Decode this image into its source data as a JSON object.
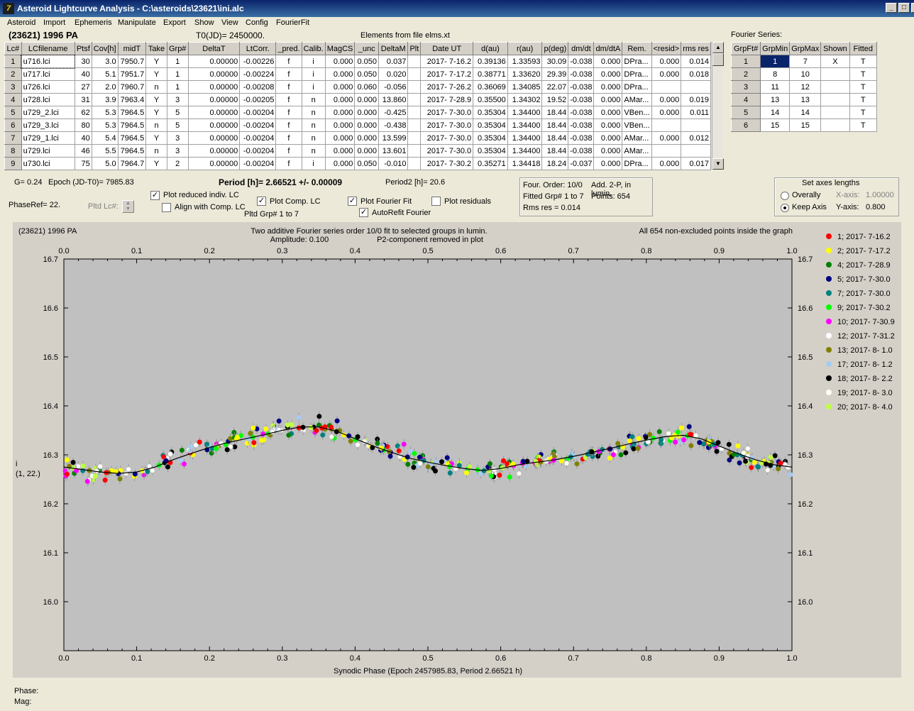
{
  "window": {
    "title": "Asteroid Lightcurve Analysis - C:\\asteroids\\23621\\ini.alc",
    "min": "_",
    "max": "□",
    "close": "X"
  },
  "menu": [
    "Asteroid",
    "Import",
    "Ephemeris",
    "Manipulate",
    "Export",
    "Show",
    "View",
    "Config",
    "FourierFit"
  ],
  "header": {
    "asteroid": "(23621) 1996 PA",
    "t0": "T0(JD)= 2450000.",
    "elements": "Elements from file elms.xt"
  },
  "lc_table": {
    "columns": [
      "Lc#",
      "LCfilename",
      "Ptsf",
      "Cov[h]",
      "midT",
      "Take",
      "Grp#",
      "DeltaT",
      "LtCorr.",
      "_pred.",
      "Calib.",
      "MagCS",
      "_unc",
      "DeltaM",
      "Plt",
      "Date UT",
      "d(au)",
      "r(au)",
      "p(deg)",
      "dm/dt",
      "dm/dtA",
      "Rem.",
      "<resid>",
      "rms res"
    ],
    "rows": [
      [
        "1",
        "u716.lci",
        "30",
        "3.0",
        "7950.7",
        "Y",
        "1",
        "0.00000",
        "-0.00226",
        "f",
        "i",
        "0.000",
        "0.050",
        "0.037",
        "",
        "2017- 7-16.2",
        "0.39136",
        "1.33593",
        "30.09",
        "-0.038",
        "0.000",
        "DPra...",
        "0.000",
        "0.014"
      ],
      [
        "2",
        "u717.lci",
        "40",
        "5.1",
        "7951.7",
        "Y",
        "1",
        "0.00000",
        "-0.00224",
        "f",
        "i",
        "0.000",
        "0.050",
        "0.020",
        "",
        "2017- 7-17.2",
        "0.38771",
        "1.33620",
        "29.39",
        "-0.038",
        "0.000",
        "DPra...",
        "0.000",
        "0.018"
      ],
      [
        "3",
        "u726.lci",
        "27",
        "2.0",
        "7960.7",
        "n",
        "1",
        "0.00000",
        "-0.00208",
        "f",
        "i",
        "0.000",
        "0.060",
        "-0.056",
        "",
        "2017- 7-26.2",
        "0.36069",
        "1.34085",
        "22.07",
        "-0.038",
        "0.000",
        "DPra...",
        "",
        ""
      ],
      [
        "4",
        "u728.lci",
        "31",
        "3.9",
        "7963.4",
        "Y",
        "3",
        "0.00000",
        "-0.00205",
        "f",
        "n",
        "0.000",
        "0.000",
        "13.860",
        "",
        "2017- 7-28.9",
        "0.35500",
        "1.34302",
        "19.52",
        "-0.038",
        "0.000",
        "AMar...",
        "0.000",
        "0.019"
      ],
      [
        "5",
        "u729_2.lci",
        "62",
        "5.3",
        "7964.5",
        "Y",
        "5",
        "0.00000",
        "-0.00204",
        "f",
        "n",
        "0.000",
        "0.000",
        "-0.425",
        "",
        "2017- 7-30.0",
        "0.35304",
        "1.34400",
        "18.44",
        "-0.038",
        "0.000",
        "VBen...",
        "0.000",
        "0.011"
      ],
      [
        "6",
        "u729_3.lci",
        "80",
        "5.3",
        "7964.5",
        "n",
        "5",
        "0.00000",
        "-0.00204",
        "f",
        "n",
        "0.000",
        "0.000",
        "-0.438",
        "",
        "2017- 7-30.0",
        "0.35304",
        "1.34400",
        "18.44",
        "-0.038",
        "0.000",
        "VBen...",
        "",
        ""
      ],
      [
        "7",
        "u729_1.lci",
        "40",
        "5.4",
        "7964.5",
        "Y",
        "3",
        "0.00000",
        "-0.00204",
        "f",
        "n",
        "0.000",
        "0.000",
        "13.599",
        "",
        "2017- 7-30.0",
        "0.35304",
        "1.34400",
        "18.44",
        "-0.038",
        "0.000",
        "AMar...",
        "0.000",
        "0.012"
      ],
      [
        "8",
        "u729.lci",
        "46",
        "5.5",
        "7964.5",
        "n",
        "3",
        "0.00000",
        "-0.00204",
        "f",
        "n",
        "0.000",
        "0.000",
        "13.601",
        "",
        "2017- 7-30.0",
        "0.35304",
        "1.34400",
        "18.44",
        "-0.038",
        "0.000",
        "AMar...",
        "",
        ""
      ],
      [
        "9",
        "u730.lci",
        "75",
        "5.0",
        "7964.7",
        "Y",
        "2",
        "0.00000",
        "-0.00204",
        "f",
        "i",
        "0.000",
        "0.050",
        "-0.010",
        "",
        "2017- 7-30.2",
        "0.35271",
        "1.34418",
        "18.24",
        "-0.037",
        "0.000",
        "DPra...",
        "0.000",
        "0.017"
      ]
    ]
  },
  "fourier": {
    "label": "Fourier Series:",
    "columns": [
      "GrpFt#",
      "GrpMin",
      "GrpMax",
      "Shown",
      "Fitted"
    ],
    "rows": [
      [
        "1",
        "1",
        "7",
        "X",
        "T"
      ],
      [
        "2",
        "8",
        "10",
        "",
        "T"
      ],
      [
        "3",
        "11",
        "12",
        "",
        "T"
      ],
      [
        "4",
        "13",
        "13",
        "",
        "T"
      ],
      [
        "5",
        "14",
        "14",
        "",
        "T"
      ],
      [
        "6",
        "15",
        "15",
        "",
        "T"
      ]
    ]
  },
  "controls": {
    "g": "G= 0.24",
    "epoch": "Epoch (JD-T0)= 7985.83",
    "period": "Period [h]= 2.66521 +/- 0.00009",
    "period2": "Period2 [h]= 20.6",
    "phaseref": "PhaseRef= 22.",
    "pltd_lc": "Pltd Lc#:",
    "plot_reduced": "Plot reduced indiv. LC",
    "align": "Align with Comp. LC",
    "plot_comp": "Plot Comp. LC",
    "pltd_grp": "Pltd Grp#  1   to   7",
    "plot_fourier": "Plot Fourier Fit",
    "autorefit": "AutoRefit Fourier",
    "plot_resid": "Plot residuals"
  },
  "info": {
    "order": "Four. Order: 10/0",
    "add": "Add. 2-P, in lumin.",
    "fitted": "Fitted Grp# 1 to 7",
    "points": "Points: 654",
    "rms": "Rms res      = 0.014"
  },
  "axes_box": {
    "title": "Set axes lengths",
    "overally": "Overally",
    "keep": "Keep Axis",
    "xaxis": "X-axis:",
    "xval": "1.00000",
    "yaxis": "Y-axis:",
    "yval": "0.800"
  },
  "status": {
    "phase": "Phase:",
    "mag": "Mag:"
  },
  "chart_data": {
    "type": "scatter",
    "title_left": "(23621) 1996 PA",
    "title_center": "Two additive Fourier series order 10/0 fit to selected groups in lumin.",
    "subtitle_amp": "Amplitude: 0.100",
    "subtitle_p2": "P2-component removed in plot",
    "note_right": "All 654 non-excluded points inside the graph",
    "xlabel": "Synodic Phase (Epoch 2457985.83, Period 2.66521 h)",
    "ylabel": [
      "i",
      "(1, 22.)"
    ],
    "xlim": [
      0,
      1
    ],
    "ylim": [
      16.7,
      15.9
    ],
    "xticks": [
      "0.0",
      "0.1",
      "0.2",
      "0.3",
      "0.4",
      "0.5",
      "0.6",
      "0.7",
      "0.8",
      "0.9",
      "1.0"
    ],
    "yticks": [
      "16.0",
      "16.1",
      "16.2",
      "16.3",
      "16.4",
      "16.5",
      "16.6",
      "16.7"
    ],
    "grid": false,
    "legend_position": "right",
    "legend": [
      {
        "label": "1; 2017- 7-16.2",
        "color": "#ff0000"
      },
      {
        "label": "2; 2017- 7-17.2",
        "color": "#ffff00"
      },
      {
        "label": "4; 2017- 7-28.9",
        "color": "#008000"
      },
      {
        "label": "5; 2017- 7-30.0",
        "color": "#000080"
      },
      {
        "label": "7; 2017- 7-30.0",
        "color": "#008080"
      },
      {
        "label": "9; 2017- 7-30.2",
        "color": "#00ff00"
      },
      {
        "label": "10; 2017- 7-30.9",
        "color": "#ff00ff"
      },
      {
        "label": "12; 2017- 7-31.2",
        "color": "#ffffff"
      },
      {
        "label": "13; 2017- 8- 1.0",
        "color": "#808000"
      },
      {
        "label": "17; 2017- 8- 1.2",
        "color": "#a6caf0"
      },
      {
        "label": "18; 2017- 8- 2.2",
        "color": "#000000"
      },
      {
        "label": "19; 2017- 8- 3.0",
        "color": "#fffff0"
      },
      {
        "label": "20; 2017- 8- 4.0",
        "color": "#c0ff40"
      }
    ],
    "fit_curve": {
      "x": [
        0.0,
        0.025,
        0.05,
        0.075,
        0.1,
        0.125,
        0.15,
        0.175,
        0.2,
        0.225,
        0.25,
        0.275,
        0.3,
        0.325,
        0.35,
        0.375,
        0.4,
        0.425,
        0.45,
        0.475,
        0.5,
        0.525,
        0.55,
        0.575,
        0.6,
        0.625,
        0.65,
        0.675,
        0.7,
        0.725,
        0.75,
        0.775,
        0.8,
        0.825,
        0.85,
        0.875,
        0.9,
        0.925,
        0.95,
        0.975,
        1.0
      ],
      "y": [
        16.275,
        16.27,
        16.265,
        16.262,
        16.265,
        16.275,
        16.29,
        16.303,
        16.315,
        16.325,
        16.333,
        16.341,
        16.35,
        16.357,
        16.357,
        16.348,
        16.333,
        16.318,
        16.305,
        16.293,
        16.285,
        16.278,
        16.272,
        16.268,
        16.272,
        16.28,
        16.285,
        16.29,
        16.297,
        16.305,
        16.313,
        16.322,
        16.33,
        16.337,
        16.34,
        16.333,
        16.318,
        16.303,
        16.29,
        16.28,
        16.275
      ]
    }
  }
}
